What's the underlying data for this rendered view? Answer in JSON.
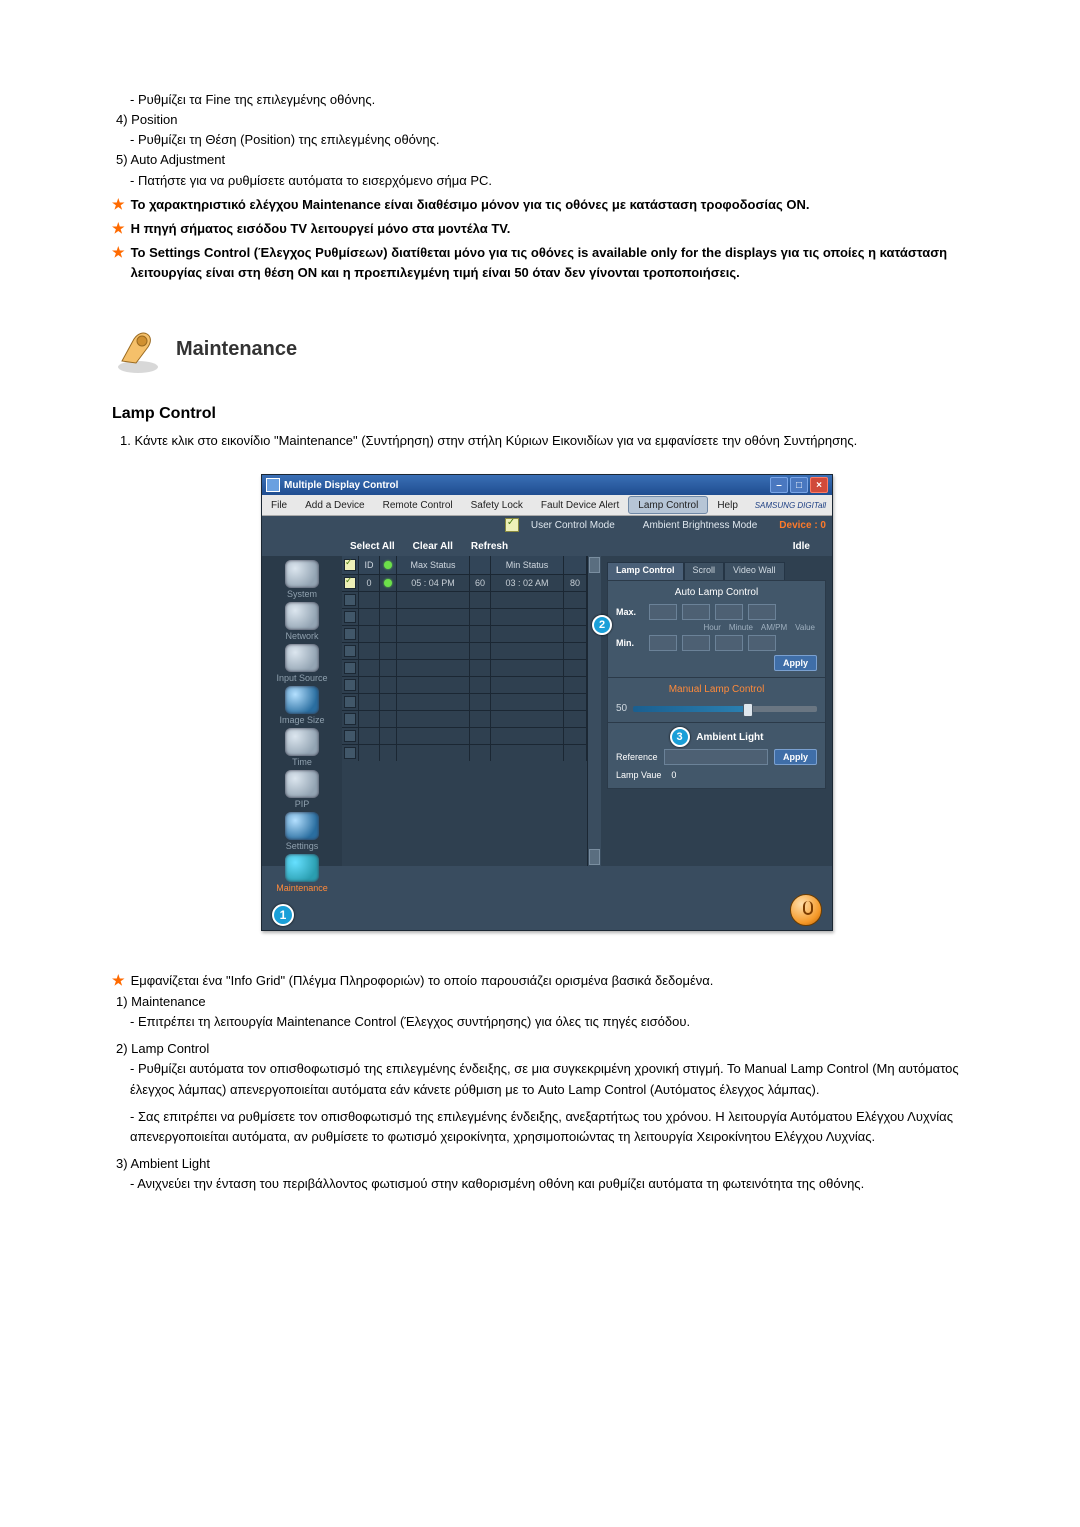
{
  "top": {
    "fine_adjust": "Ρυθμίζει τα Fine της επιλεγμένης οθόνης.",
    "item4_label": "4)  Position",
    "item4_desc": "Ρυθμίζει τη Θέση (Position) της επιλεγμένης οθόνης.",
    "item5_label": "5)  Auto Adjustment",
    "item5_desc": "Πατήστε για να ρυθμίσετε αυτόματα το εισερχόμενο σήμα PC.",
    "star1": "Το χαρακτηριστικό ελέγχου Maintenance είναι διαθέσιμο μόνον για τις οθόνες με κατάσταση τροφοδοσίας ON.",
    "star2": "Η πηγή σήματος εισόδου TV λειτουργεί μόνο στα μοντέλα TV.",
    "star3": "Το Settings Control (Έλεγχος Ρυθμίσεων) διατίθεται μόνο για τις οθόνες is available only for the displays για τις οποίες η κατάσταση λειτουργίας είναι στη θέση ON και η προεπιλεγμένη τιμή είναι 50 όταν δεν γίνονται τροποποιήσεις."
  },
  "section": {
    "title": "Maintenance",
    "sub": "Lamp Control"
  },
  "intro_ol": "1.  Κάντε κλικ στο εικονίδιο \"Maintenance\" (Συντήρηση) στην στήλη Κύριων Εικονιδίων για να εμφανίσετε την οθόνη Συντήρησης.",
  "shot": {
    "title": "Multiple Display Control",
    "menus": [
      "File",
      "Add a Device",
      "Remote Control",
      "Safety Lock",
      "Fault Device Alert",
      "Lamp Control",
      "Help"
    ],
    "brand": "SAMSUNG DIGITall",
    "modes": {
      "user": "User Control Mode",
      "ambient": "Ambient Brightness Mode"
    },
    "device_lbl": "Device : 0",
    "toolbar": [
      "Select All",
      "Clear All",
      "Refresh"
    ],
    "idle": "Idle",
    "side": [
      "System",
      "Network",
      "Input Source",
      "Image Size",
      "Time",
      "PIP",
      "Settings",
      "Maintenance"
    ],
    "grid_head": [
      "ID",
      "",
      "Max Status",
      "",
      "Min Status",
      ""
    ],
    "grid_row": {
      "id": "0",
      "max": "05 : 04  PM",
      "maxv": "60",
      "min": "03 : 02  AM",
      "minv": "80"
    },
    "tabs": [
      "Lamp Control",
      "Scroll",
      "Video Wall"
    ],
    "panel": {
      "auto_title": "Auto Lamp Control",
      "max": "Max.",
      "min": "Min.",
      "col_heads": [
        "Hour",
        "Minute",
        "AM/PM",
        "Value"
      ],
      "apply": "Apply",
      "manual_title": "Manual Lamp Control",
      "slider_val": "50",
      "amb_title": "Ambient Light",
      "reference": "Reference",
      "lamp_value_lbl": "Lamp Vaue",
      "lamp_value": "0"
    },
    "markers": {
      "m1": "1",
      "m2": "2",
      "m3": "3"
    }
  },
  "below": {
    "star_info": "Εμφανίζεται ένα \"Info Grid\" (Πλέγμα Πληροφοριών) το οποίο παρουσιάζει ορισμένα βασικά δεδομένα.",
    "i1_label": "1)  Maintenance",
    "i1_desc": "Επιτρέπει τη λειτουργία Maintenance Control (Έλεγχος συντήρησης) για όλες τις πηγές εισόδου.",
    "i2_label": "2)  Lamp Control",
    "i2_desc_a": "Ρυθμίζει αυτόματα τον οπισθοφωτισμό της επιλεγμένης ένδειξης, σε μια συγκεκριμένη χρονική στιγμή. Το Manual Lamp Control (Μη αυτόματος έλεγχος λάμπας) απενεργοποιείται αυτόματα εάν κάνετε ρύθμιση με το Auto Lamp Control (Αυτόματος έλεγχος λάμπας).",
    "i2_desc_b": "Σας επιτρέπει να ρυθμίσετε τον οπισθοφωτισμό της επιλεγμένης ένδειξης, ανεξαρτήτως του χρόνου. Η λειτουργία Αυτόματου Ελέγχου Λυχνίας απενεργοποιείται αυτόματα, αν ρυθμίσετε το φωτισμό χειροκίνητα, χρησιμοποιώντας τη λειτουργία Χειροκίνητου Ελέγχου Λυχνίας.",
    "i3_label": "3)  Ambient Light",
    "i3_desc": "Ανιχνεύει την ένταση του περιβάλλοντος φωτισμού στην καθορισμένη οθόνη και ρυθμίζει αυτόματα τη φωτεινότητα της οθόνης."
  }
}
